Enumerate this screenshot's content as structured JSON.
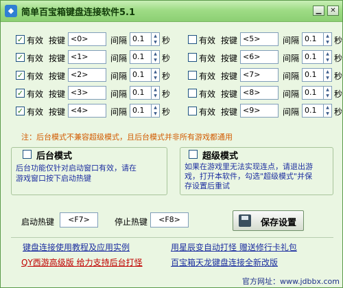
{
  "window": {
    "title": "简单百宝箱键盘连接软件5.1",
    "min_symbol": "▁",
    "close_symbol": "✕"
  },
  "labels": {
    "enabled": "有效",
    "key": "按键",
    "interval": "间隔",
    "second": "秒"
  },
  "keys_left": [
    {
      "key": "<0>",
      "interval": "0.1",
      "checked": true
    },
    {
      "key": "<1>",
      "interval": "0.1",
      "checked": true
    },
    {
      "key": "<2>",
      "interval": "0.1",
      "checked": true
    },
    {
      "key": "<3>",
      "interval": "0.1",
      "checked": true
    },
    {
      "key": "<4>",
      "interval": "0.1",
      "checked": true
    }
  ],
  "keys_right": [
    {
      "key": "<5>",
      "interval": "0.1",
      "checked": false
    },
    {
      "key": "<6>",
      "interval": "0.1",
      "checked": false
    },
    {
      "key": "<7>",
      "interval": "0.1",
      "checked": false
    },
    {
      "key": "<8>",
      "interval": "0.1",
      "checked": false
    },
    {
      "key": "<9>",
      "interval": "0.1",
      "checked": false
    }
  ],
  "note": "注：后台模式不兼容超级模式，且后台模式并非所有游戏都通用",
  "background_mode": {
    "title": "后台模式",
    "checked": false,
    "desc_line1": "后台功能仅针对启动窗口有效，请在",
    "desc_line2": "游戏窗口按下启动热键"
  },
  "super_mode": {
    "title": "超级模式",
    "checked": false,
    "desc_line1": "如果在游戏里无法实现连点，请退出游",
    "desc_line2": "戏，打开本软件，勾选\"超级模式\"并保",
    "desc_line3": "存设置后重试"
  },
  "hotkeys": {
    "start_label": "启动热键",
    "start_value": "<F7>",
    "stop_label": "停止热键",
    "stop_value": "<F8>"
  },
  "save_button": "保存设置",
  "links": {
    "tutorial": "键盘连接使用教程及应用实例",
    "auto_fight": "用星辰变自动打怪 赠送修行卡礼包",
    "qy": "QY西游高级版 给力支持后台打怪",
    "baibaoxiang": "百宝箱天龙键盘连接全新改版"
  },
  "footer": "官方网址：www.jdbbx.com",
  "colors": {
    "titlebar": "#9fdc86",
    "window_bg": "#eaf6e2",
    "note": "#d25a00",
    "link_blue": "#1d2fa0",
    "link_red": "#c00000"
  }
}
